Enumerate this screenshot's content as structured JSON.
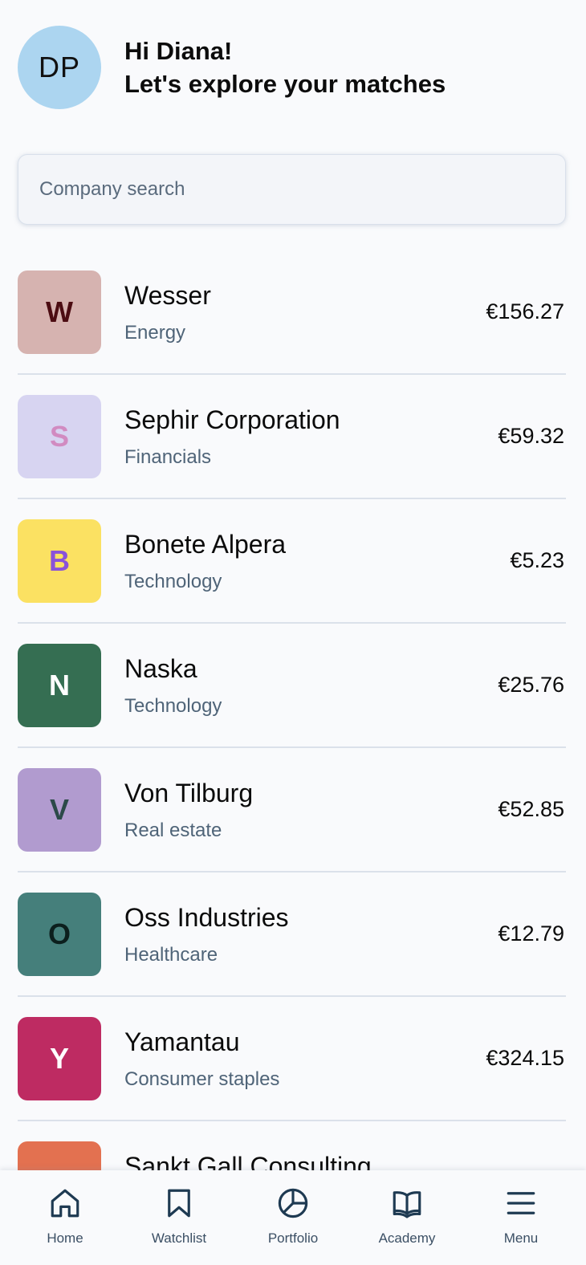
{
  "user": {
    "initials": "DP",
    "greeting": "Hi Diana!",
    "subtitle": "Let's explore your matches"
  },
  "search": {
    "placeholder": "Company search",
    "value": ""
  },
  "companies": [
    {
      "letter": "W",
      "name": "Wesser",
      "sector": "Energy",
      "price": "€156.27",
      "tile_bg": "#d6b3b0",
      "tile_fg": "#4c0c12"
    },
    {
      "letter": "S",
      "name": "Sephir Corporation",
      "sector": "Financials",
      "price": "€59.32",
      "tile_bg": "#d7d4f1",
      "tile_fg": "#d18bc1"
    },
    {
      "letter": "B",
      "name": "Bonete Alpera",
      "sector": "Technology",
      "price": "€5.23",
      "tile_bg": "#fbe162",
      "tile_fg": "#8a52d9"
    },
    {
      "letter": "N",
      "name": "Naska",
      "sector": "Technology",
      "price": "€25.76",
      "tile_bg": "#356e52",
      "tile_fg": "#ffffff"
    },
    {
      "letter": "V",
      "name": "Von Tilburg",
      "sector": "Real estate",
      "price": "€52.85",
      "tile_bg": "#b19bcf",
      "tile_fg": "#2c4a49"
    },
    {
      "letter": "O",
      "name": "Oss Industries",
      "sector": "Healthcare",
      "price": "€12.79",
      "tile_bg": "#457f7b",
      "tile_fg": "#0c1f1d"
    },
    {
      "letter": "Y",
      "name": "Yamantau",
      "sector": "Consumer staples",
      "price": "€324.15",
      "tile_bg": "#be2b62",
      "tile_fg": "#ffffff"
    },
    {
      "letter": "",
      "name": "Sankt Gall Consulting",
      "sector": "",
      "price": "",
      "tile_bg": "#e37150",
      "tile_fg": "#ffffff"
    }
  ],
  "nav": [
    {
      "label": "Home",
      "icon": "home-icon"
    },
    {
      "label": "Watchlist",
      "icon": "bookmark-icon"
    },
    {
      "label": "Portfolio",
      "icon": "pie-chart-icon"
    },
    {
      "label": "Academy",
      "icon": "book-icon"
    },
    {
      "label": "Menu",
      "icon": "menu-icon"
    }
  ],
  "colors": {
    "background": "#f9fafc",
    "divider": "#dbe1ea",
    "muted_text": "#4f6478",
    "nav_icon": "#1e3a52",
    "avatar_bg": "#acd5f0"
  }
}
